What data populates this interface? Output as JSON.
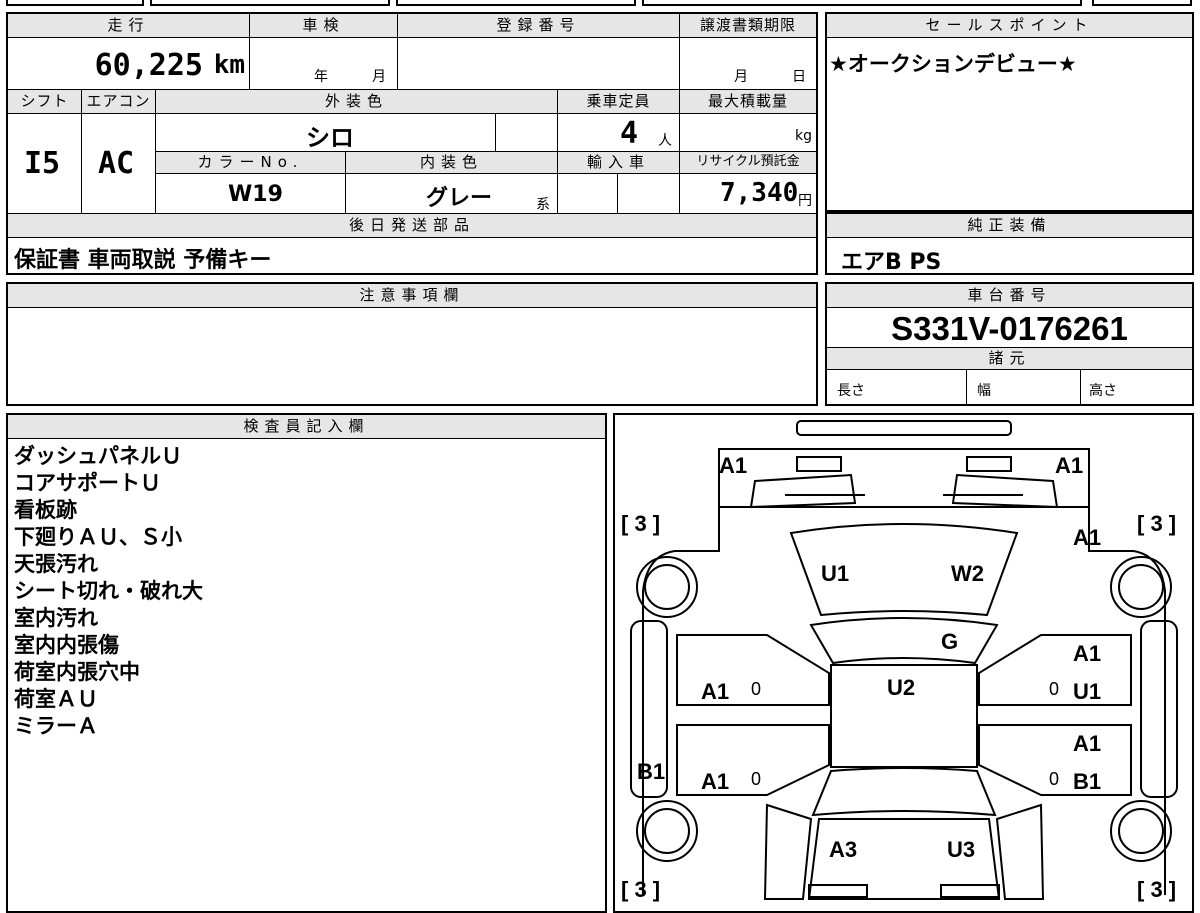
{
  "headers": {
    "mileage": "走行",
    "inspection": "車検",
    "registration": "登録番号",
    "transfer_deadline": "譲渡書類期限",
    "sales_point": "セールスポイント",
    "shift": "シフト",
    "aircon": "エアコン",
    "exterior_color": "外装色",
    "capacity": "乗車定員",
    "max_load": "最大積載量",
    "color_no": "カラーNo.",
    "interior_color": "内装色",
    "import": "輸入車",
    "recycle": "リサイクル預託金",
    "later_parts": "後日発送部品",
    "genuine_equipment": "純正装備",
    "caution": "注意事項欄",
    "chassis_number": "車台番号",
    "specs": "諸元",
    "inspector": "検査員記入欄"
  },
  "vehicle": {
    "mileage_value": "60,225",
    "mileage_unit": "km",
    "inspection_year_unit": "年",
    "inspection_month_unit": "月",
    "deadline_month_unit": "月",
    "deadline_day_unit": "日",
    "shift": "I5",
    "aircon": "AC",
    "exterior_color": "シロ",
    "capacity_value": "4",
    "capacity_unit": "人",
    "max_load_unit": "kg",
    "color_no": "W19",
    "interior_color": "グレー",
    "interior_color_suffix": "系",
    "recycle_value": "7,340",
    "recycle_unit": "円",
    "chassis_number": "S331V-0176261",
    "spec_length": "長さ",
    "spec_width": "幅",
    "spec_height": "高さ"
  },
  "sales_point_text": "★オークションデビュー★",
  "later_parts_text": "保証書 車両取説 予備キー",
  "genuine_equipment_text": "エアB PS",
  "inspector_notes": [
    "ダッシュパネルＵ",
    "コアサポートＵ",
    "看板跡",
    "下廻りＡＵ、Ｓ小",
    "天張汚れ",
    "シート切れ・破れ大",
    "室内汚れ",
    "室内内張傷",
    "荷室内張穴中",
    "荷室ＡＵ",
    "ミラーＡ"
  ],
  "diagram": {
    "front_left": "A1",
    "front_right": "A1",
    "tire_fl": "[ 3 ]",
    "tire_fr": "[ 3 ]",
    "tire_rl": "[ 3 ]",
    "tire_rr": "[ 3 ]",
    "fender_right": "A1",
    "hood_left": "U1",
    "hood_right": "W2",
    "windshield": "G",
    "roof": "U2",
    "left_front_door": "A1",
    "left_rear_door": "A1",
    "left_front_zero": "0",
    "left_rear_zero": "0",
    "left_rocker": "B1",
    "right_front_door_a": "A1",
    "right_front_door_u": "U1",
    "right_rear_door_a": "A1",
    "right_rear_door_b": "B1",
    "right_front_zero": "0",
    "right_rear_zero": "0",
    "rear_left": "A3",
    "rear_right": "U3"
  }
}
